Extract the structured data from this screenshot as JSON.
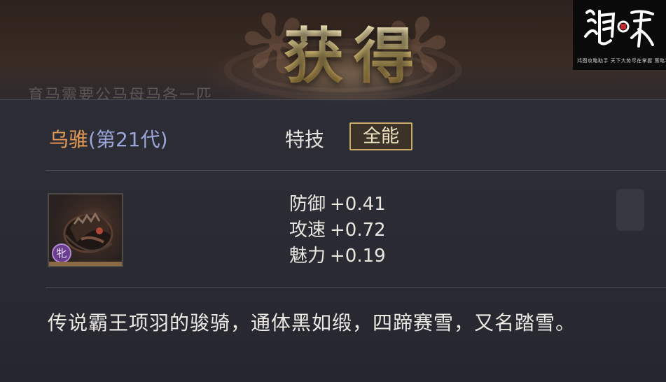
{
  "background": {
    "faded_text": "育马需要公马母马各一匹"
  },
  "popup": {
    "title": "获得",
    "horse": {
      "name": "乌骓",
      "generation": "(第21代)"
    },
    "skill": {
      "label": "特技",
      "value": "全能"
    },
    "item": {
      "icon": "black-warhorse-icon",
      "tier_badge": "牝"
    },
    "stats": [
      {
        "label": "防御",
        "value": "+0.41"
      },
      {
        "label": "攻速",
        "value": "+0.72"
      },
      {
        "label": "魅力",
        "value": "+0.19"
      }
    ],
    "description": "传说霸王项羽的骏骑，通体黑如缎，四蹄赛雪，又名踏雪。"
  },
  "watermark": {
    "logo_text": "鸿图之下",
    "tagline": "鸿图攻略助手 天下大势尽在掌握 策略手游"
  },
  "colors": {
    "name_orange": "#e59a55",
    "generation_blue": "#9aa5d8",
    "title_gold": "#e2c77a",
    "badge_border": "#c9a868",
    "tier_purple": "#6a3d8f"
  }
}
